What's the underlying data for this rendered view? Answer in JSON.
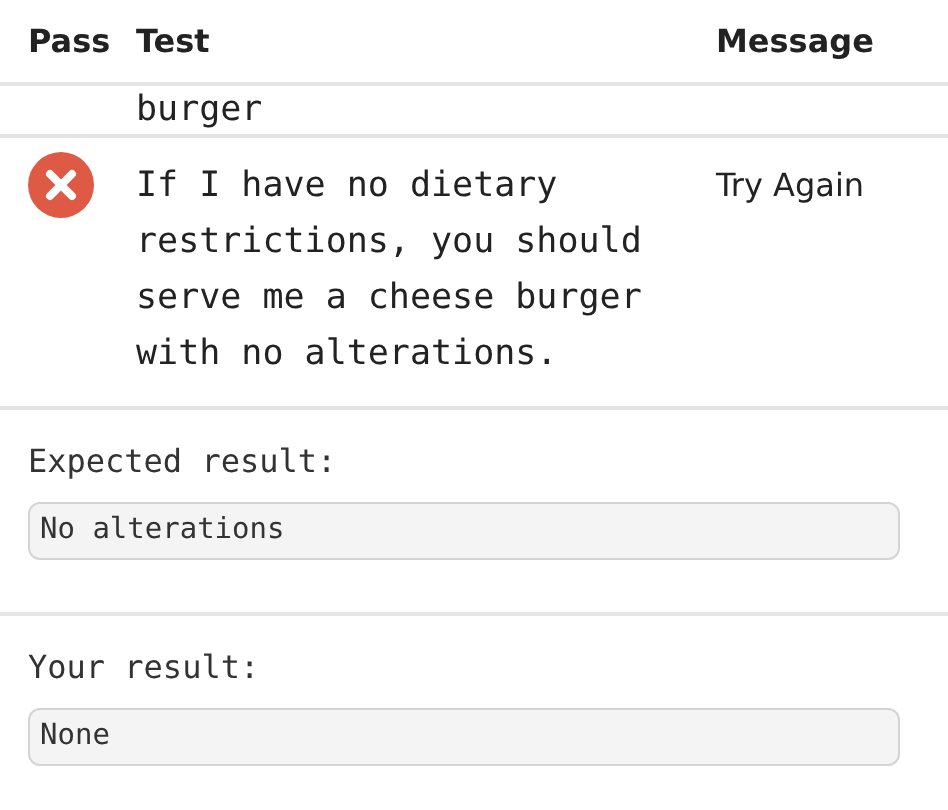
{
  "table": {
    "columns": [
      "Pass",
      "Test",
      "Message"
    ],
    "rows": [
      {
        "test": "burger",
        "message": "",
        "passed": null
      },
      {
        "test": "If I have no dietary restrictions, you should serve me a cheese burger with no alterations.",
        "message": "Try Again",
        "passed": false
      }
    ]
  },
  "results": [
    {
      "label": "Expected result:",
      "value": "No alterations"
    },
    {
      "label": "Your result:",
      "value": "None"
    }
  ]
}
